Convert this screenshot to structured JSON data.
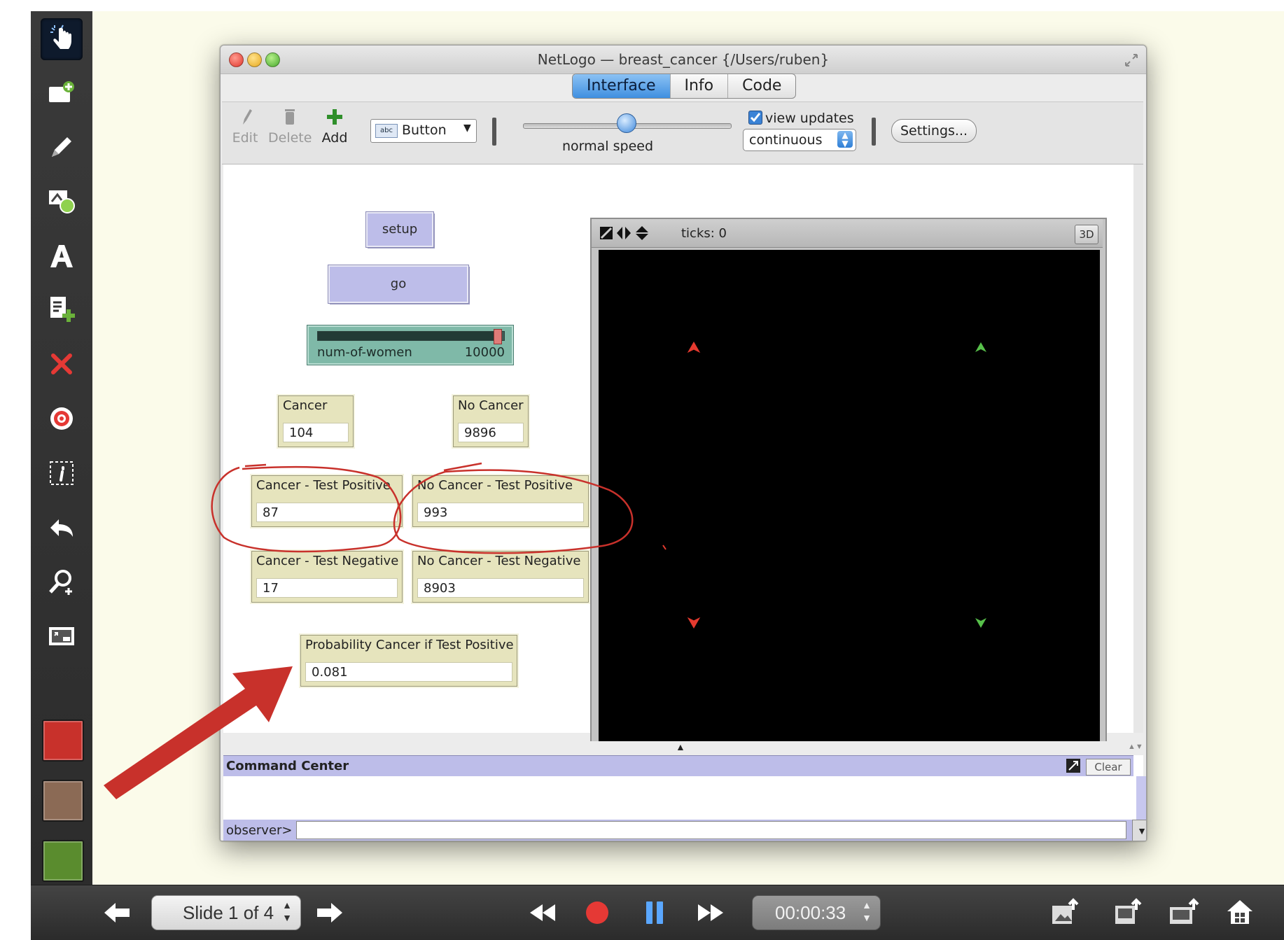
{
  "left_toolbar": {
    "tools": [
      {
        "name": "pointer-tool",
        "icon": "hand-pointer-icon",
        "active": true
      },
      {
        "name": "add-slide-tool",
        "icon": "add-slide-icon"
      },
      {
        "name": "pen-tool",
        "icon": "pen-icon"
      },
      {
        "name": "shape-tool",
        "icon": "shapes-icon"
      },
      {
        "name": "text-tool",
        "icon": "text-a-icon"
      },
      {
        "name": "add-note-tool",
        "icon": "add-note-icon"
      },
      {
        "name": "delete-tool",
        "icon": "red-x-icon"
      },
      {
        "name": "target-tool",
        "icon": "target-icon"
      },
      {
        "name": "info-tool",
        "icon": "info-box-icon"
      },
      {
        "name": "undo-tool",
        "icon": "undo-arrow-icon"
      },
      {
        "name": "zoom-tool",
        "icon": "magnifier-plus-icon"
      },
      {
        "name": "screen-tool",
        "icon": "screen-icon"
      }
    ],
    "swatches": [
      "#c8312b",
      "#8b6a55",
      "#5a8c2e"
    ]
  },
  "bottom_bar": {
    "slide_indicator": "Slide 1 of 4",
    "timer": "00:00:33",
    "record_color": "#e53935",
    "pause_color": "#5aa7ff"
  },
  "netlogo": {
    "window_title": "NetLogo — breast_cancer {/Users/ruben}",
    "tabs": [
      "Interface",
      "Info",
      "Code"
    ],
    "selected_tab": "Interface",
    "toolbar": {
      "edit_label": "Edit",
      "delete_label": "Delete",
      "add_label": "Add",
      "widget_type": "Button",
      "speed_label": "normal speed",
      "view_updates_label": "view updates",
      "update_mode": "continuous",
      "settings_label": "Settings..."
    },
    "widgets": {
      "setup_label": "setup",
      "go_label": "go",
      "slider": {
        "name": "num-of-women",
        "value": "10000",
        "fraction": 0.98
      },
      "monitors": [
        {
          "label": "Cancer",
          "value": "104"
        },
        {
          "label": "No Cancer",
          "value": "9896"
        },
        {
          "label": "Cancer - Test Positive",
          "value": "87"
        },
        {
          "label": "No Cancer - Test Positive",
          "value": "993"
        },
        {
          "label": "Cancer - Test Negative",
          "value": "17"
        },
        {
          "label": "No Cancer - Test Negative",
          "value": "8903"
        },
        {
          "label": "Probability Cancer if Test Positive",
          "value": "0.081"
        }
      ]
    },
    "view": {
      "ticks_label": "ticks: 0",
      "btn_3d": "3D",
      "turtle_colors": {
        "cancer": "#e53a2f",
        "no_cancer": "#57c04a"
      }
    },
    "command_center": {
      "title": "Command Center",
      "clear_label": "Clear",
      "prompt": "observer>"
    }
  },
  "annotation_colors": {
    "circle": "#c8312b",
    "arrow": "#c8312b"
  }
}
